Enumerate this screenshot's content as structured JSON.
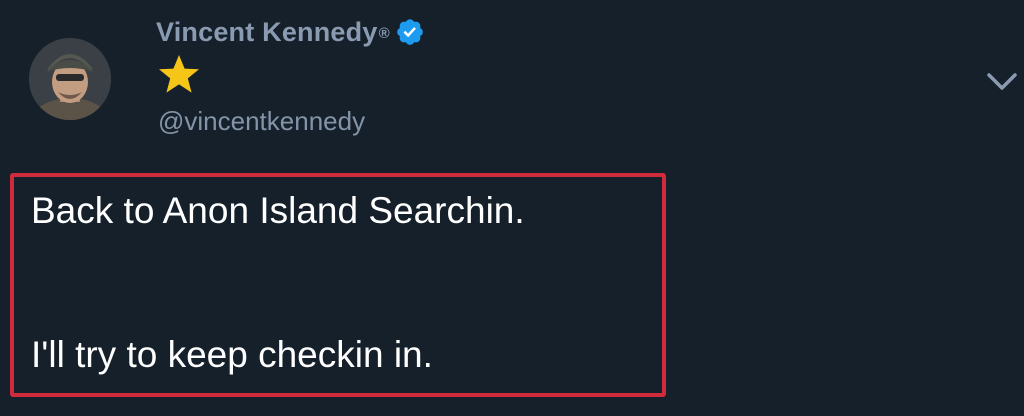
{
  "tweet": {
    "author": {
      "display_name": "Vincent Kennedy",
      "registered_mark": "®",
      "handle": "@vincentkennedy",
      "verified": true,
      "badge_icon": "verified-badge-icon",
      "emoji_icon": "star-icon",
      "avatar_icon": "avatar"
    },
    "menu_icon": "chevron-down-icon",
    "text_lines": [
      "Back to Anon Island Searchin.",
      "I'll try to keep checkin in."
    ],
    "highlight_color": "#d02b3c"
  },
  "colors": {
    "background": "#15202b",
    "name": "#8a9bb1",
    "handle": "#8494a8",
    "verified": "#1d9bf0",
    "star": "#f5c518",
    "text": "#ffffff"
  }
}
